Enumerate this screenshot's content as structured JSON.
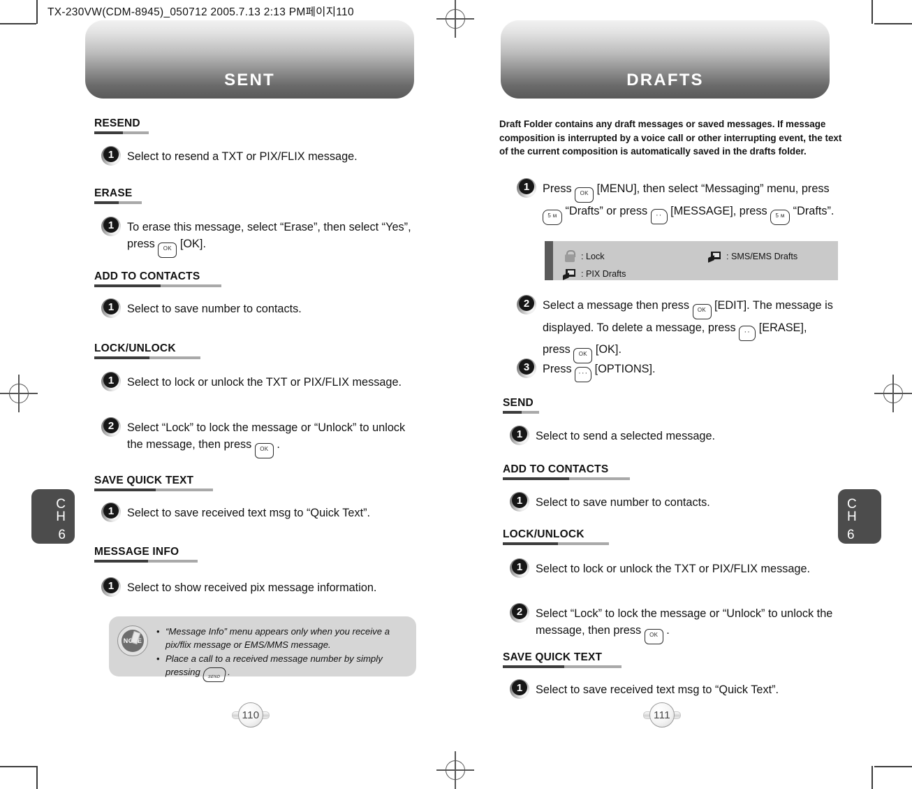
{
  "print_header": "TX-230VW(CDM-8945)_050712  2005.7.13 2:13 PM페이지110",
  "left_page": {
    "banner_title": "SENT",
    "page_number": "110",
    "chapter": {
      "c": "C",
      "h": "H",
      "num": "6"
    },
    "sections": [
      {
        "title": "RESEND",
        "steps": [
          {
            "num": "1",
            "parts": [
              {
                "t": "text",
                "v": "Select to resend a TXT or PIX/FLIX message."
              }
            ]
          }
        ]
      },
      {
        "title": "ERASE",
        "steps": [
          {
            "num": "1",
            "parts": [
              {
                "t": "text",
                "v": "To erase this message, select “Erase”, then select “Yes”, press "
              },
              {
                "t": "key",
                "k": "ok",
                "v": "OK"
              },
              {
                "t": "text",
                "v": " [OK]."
              }
            ]
          }
        ]
      },
      {
        "title": "ADD TO CONTACTS",
        "steps": [
          {
            "num": "1",
            "parts": [
              {
                "t": "text",
                "v": "Select to save number to contacts."
              }
            ]
          }
        ]
      },
      {
        "title": "LOCK/UNLOCK",
        "steps": [
          {
            "num": "1",
            "parts": [
              {
                "t": "text",
                "v": "Select to lock or unlock the TXT or PIX/FLIX message."
              }
            ]
          },
          {
            "num": "2",
            "parts": [
              {
                "t": "text",
                "v": "Select “Lock” to lock the message or “Unlock” to unlock the message, then press "
              },
              {
                "t": "key",
                "k": "ok",
                "v": "OK"
              },
              {
                "t": "text",
                "v": " ."
              }
            ]
          }
        ]
      },
      {
        "title": "SAVE QUICK TEXT",
        "steps": [
          {
            "num": "1",
            "parts": [
              {
                "t": "text",
                "v": "Select to save received text msg to “Quick Text”."
              }
            ]
          }
        ]
      },
      {
        "title": "MESSAGE INFO",
        "steps": [
          {
            "num": "1",
            "parts": [
              {
                "t": "text",
                "v": "Select to show received pix message information."
              }
            ]
          }
        ]
      }
    ],
    "note": {
      "label": "NOTE",
      "items": [
        {
          "parts": [
            {
              "t": "text",
              "v": "“Message Info” menu appears only when you receive a pix/flix message or EMS/MMS message."
            }
          ]
        },
        {
          "parts": [
            {
              "t": "text",
              "v": "Place a call to a received message number by simply pressing "
            },
            {
              "t": "key",
              "k": "send",
              "v": "SEND"
            },
            {
              "t": "text",
              "v": " ."
            }
          ]
        }
      ]
    }
  },
  "right_page": {
    "banner_title": "DRAFTS",
    "page_number": "111",
    "chapter": {
      "c": "C",
      "h": "H",
      "num": "6"
    },
    "intro": "Draft Folder contains any draft messages or saved messages.\nIf message composition is interrupted by a voice call or other\ninterrupting event, the text of the current composition is automatically\nsaved in the drafts folder.",
    "top_steps": [
      {
        "num": "1",
        "parts": [
          {
            "t": "text",
            "v": "Press "
          },
          {
            "t": "key",
            "k": "ok",
            "v": "OK"
          },
          {
            "t": "text",
            "v": " [MENU], then select “Messaging” menu, press "
          },
          {
            "t": "key",
            "k": "num",
            "v": "5 м"
          },
          {
            "t": "text",
            "v": " “Drafts” or press "
          },
          {
            "t": "key",
            "k": "soft2",
            "v": "··"
          },
          {
            "t": "text",
            "v": " [MESSAGE], press "
          },
          {
            "t": "key",
            "k": "num",
            "v": "5 м"
          },
          {
            "t": "text",
            "v": " “Drafts”."
          }
        ]
      },
      {
        "num": "2",
        "parts": [
          {
            "t": "text",
            "v": "Select a message then press "
          },
          {
            "t": "key",
            "k": "ok",
            "v": "OK"
          },
          {
            "t": "text",
            "v": " [EDIT]. The message is displayed. To delete a message, press "
          },
          {
            "t": "key",
            "k": "soft2",
            "v": "··"
          },
          {
            "t": "text",
            "v": " [ERASE], press "
          },
          {
            "t": "key",
            "k": "ok",
            "v": "OK"
          },
          {
            "t": "text",
            "v": " [OK]."
          }
        ]
      },
      {
        "num": "3",
        "parts": [
          {
            "t": "text",
            "v": "Press "
          },
          {
            "t": "key",
            "k": "soft3",
            "v": "···"
          },
          {
            "t": "text",
            "v": " [OPTIONS]."
          }
        ]
      }
    ],
    "legend": [
      {
        "icon": "lock-icon",
        "label": ": Lock"
      },
      {
        "icon": "sms-draft-icon",
        "label": ": SMS/EMS Drafts"
      },
      {
        "icon": "pix-draft-icon",
        "label": ": PIX Drafts"
      }
    ],
    "sections": [
      {
        "title": "SEND",
        "steps": [
          {
            "num": "1",
            "parts": [
              {
                "t": "text",
                "v": "Select to send a selected message."
              }
            ]
          }
        ]
      },
      {
        "title": "ADD TO CONTACTS",
        "steps": [
          {
            "num": "1",
            "parts": [
              {
                "t": "text",
                "v": "Select to save number to contacts."
              }
            ]
          }
        ]
      },
      {
        "title": "LOCK/UNLOCK",
        "steps": [
          {
            "num": "1",
            "parts": [
              {
                "t": "text",
                "v": "Select to lock or unlock the TXT or PIX/FLIX message."
              }
            ]
          },
          {
            "num": "2",
            "parts": [
              {
                "t": "text",
                "v": "Select “Lock” to lock the message or “Unlock” to unlock the message, then press "
              },
              {
                "t": "key",
                "k": "ok",
                "v": "OK"
              },
              {
                "t": "text",
                "v": " ."
              }
            ]
          }
        ]
      },
      {
        "title": "SAVE QUICK TEXT",
        "steps": [
          {
            "num": "1",
            "parts": [
              {
                "t": "text",
                "v": "Select to save received text msg to “Quick Text”."
              }
            ]
          }
        ]
      }
    ]
  },
  "colors": {
    "banner_dark": "#5a5a5a",
    "rule_dark": "#3c3c3c",
    "rule_light": "#a9a9a9",
    "tab": "#4c4c4c"
  }
}
